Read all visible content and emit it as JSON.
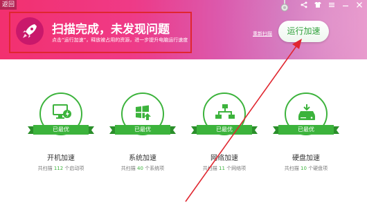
{
  "topbar": {
    "back_label": "返回",
    "icons": [
      "share-icon",
      "shirt-icon",
      "menu-icon",
      "minimize-icon",
      "close-icon"
    ]
  },
  "banner": {
    "title": "扫描完成，未发现问题",
    "subtitle": "点击“运行加速”，释放被占用的资源，进一步提升电脑运行速度",
    "rescan_label": "重新扫描",
    "run_button_label": "运行加速"
  },
  "colors": {
    "accent": "#3cb33c",
    "banner_pink": "#f2306f",
    "highlight_red": "#e0262f"
  },
  "cards": [
    {
      "name": "开机加速",
      "status": "已最优",
      "desc_prefix": "共扫描",
      "count": "112",
      "desc_suffix": "个启动项",
      "icon": "monitor-bolt-icon"
    },
    {
      "name": "系统加速",
      "status": "已最优",
      "desc_prefix": "共扫描",
      "count": "40",
      "desc_suffix": "个系统项",
      "icon": "windows-icon"
    },
    {
      "name": "网络加速",
      "status": "已最优",
      "desc_prefix": "共扫描",
      "count": "11",
      "desc_suffix": "个网络项",
      "icon": "network-icon"
    },
    {
      "name": "硬盘加速",
      "status": "已最优",
      "desc_prefix": "共扫描",
      "count": "10",
      "desc_suffix": "个硬盘项",
      "icon": "hard-disk-icon"
    }
  ]
}
